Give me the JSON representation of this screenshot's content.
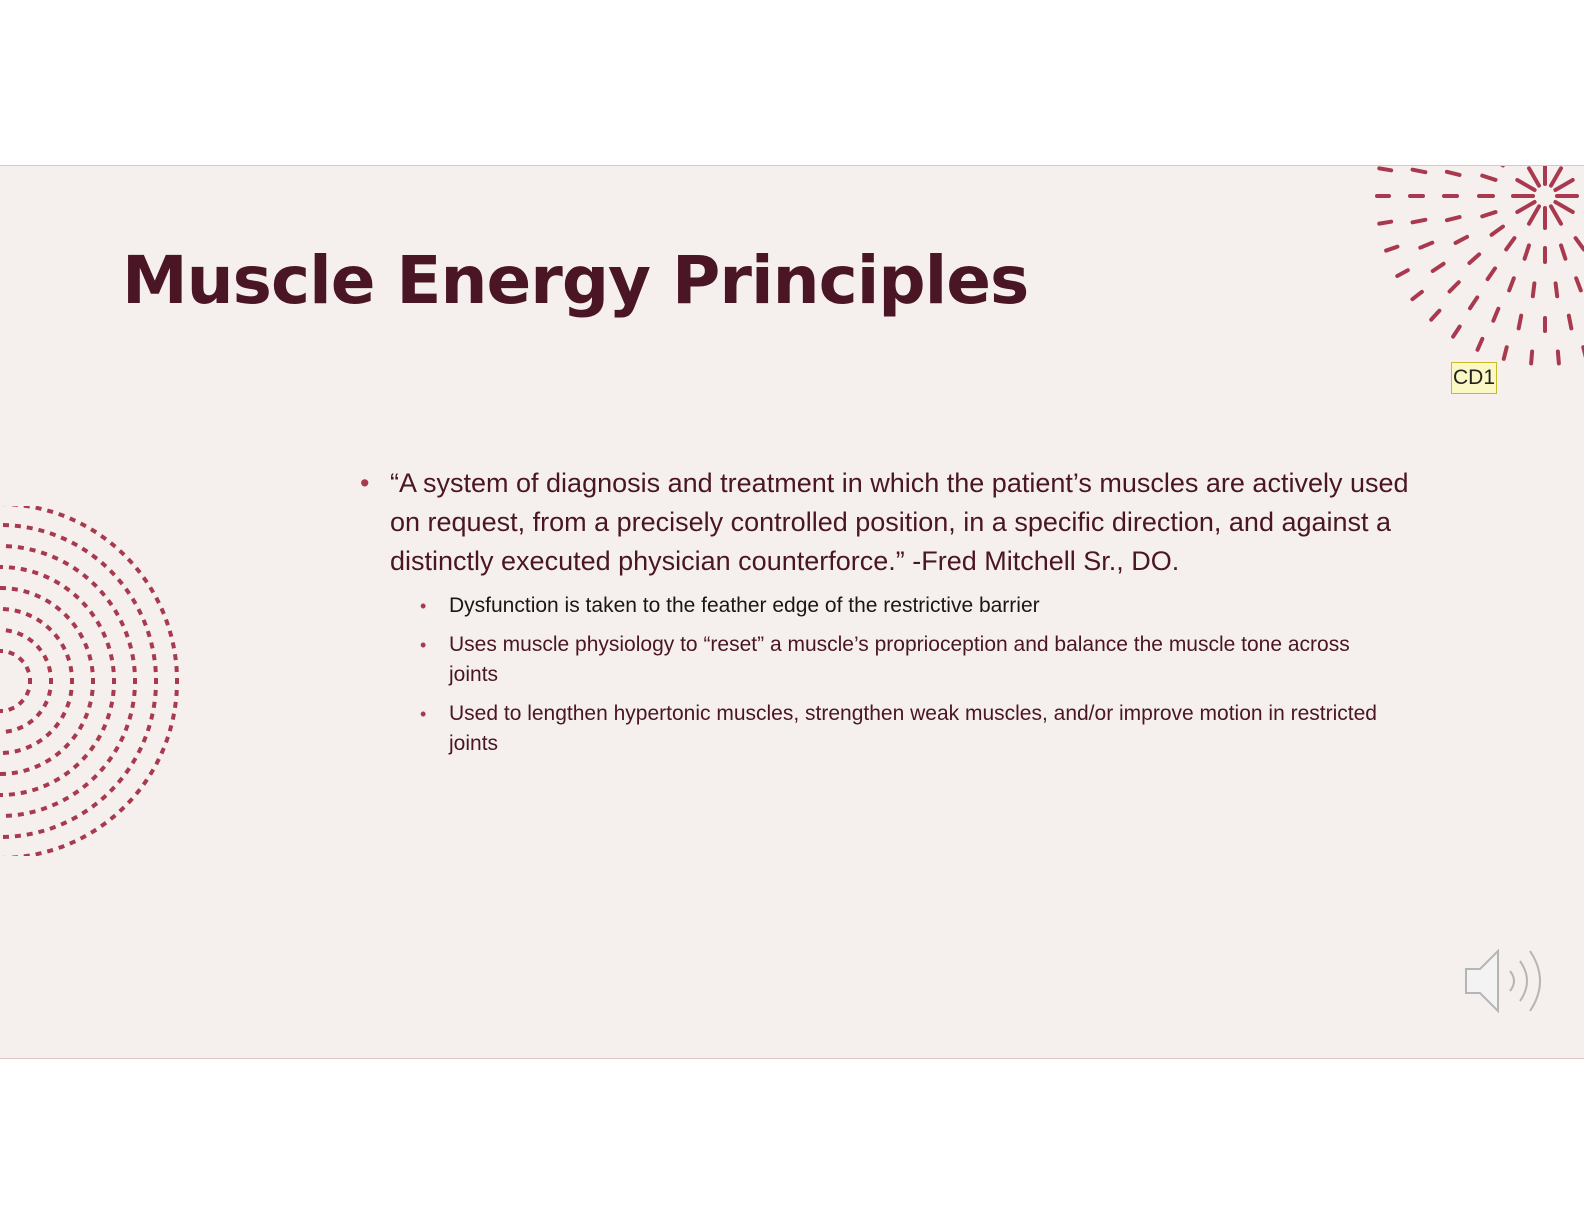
{
  "slide": {
    "title": "Muscle Energy Principles",
    "comment_marker": "CD1",
    "main_bullet": "“A system of diagnosis and treatment in which the patient’s muscles are actively used on request, from a precisely controlled position, in a specific direction, and against a distinctly executed physician counterforce.” -Fred Mitchell Sr., DO.",
    "sub_bullets": [
      "Dysfunction is taken to the feather edge of the restrictive barrier",
      "Uses muscle physiology to “reset” a muscle’s proprioception and balance the muscle tone across joints",
      "Used to lengthen hypertonic muscles, strengthen weak muscles, and/or improve motion in restricted joints"
    ],
    "bullet_glyph": "•",
    "icons": {
      "audio": "speaker-icon",
      "decor_top_right": "burst-pattern-icon",
      "decor_left": "concentric-dots-pattern-icon"
    }
  },
  "colors": {
    "title": "#4a1524",
    "accent": "#a8394e",
    "slide_background": "#f5f0ee",
    "comment_background": "#fbf8c6"
  }
}
